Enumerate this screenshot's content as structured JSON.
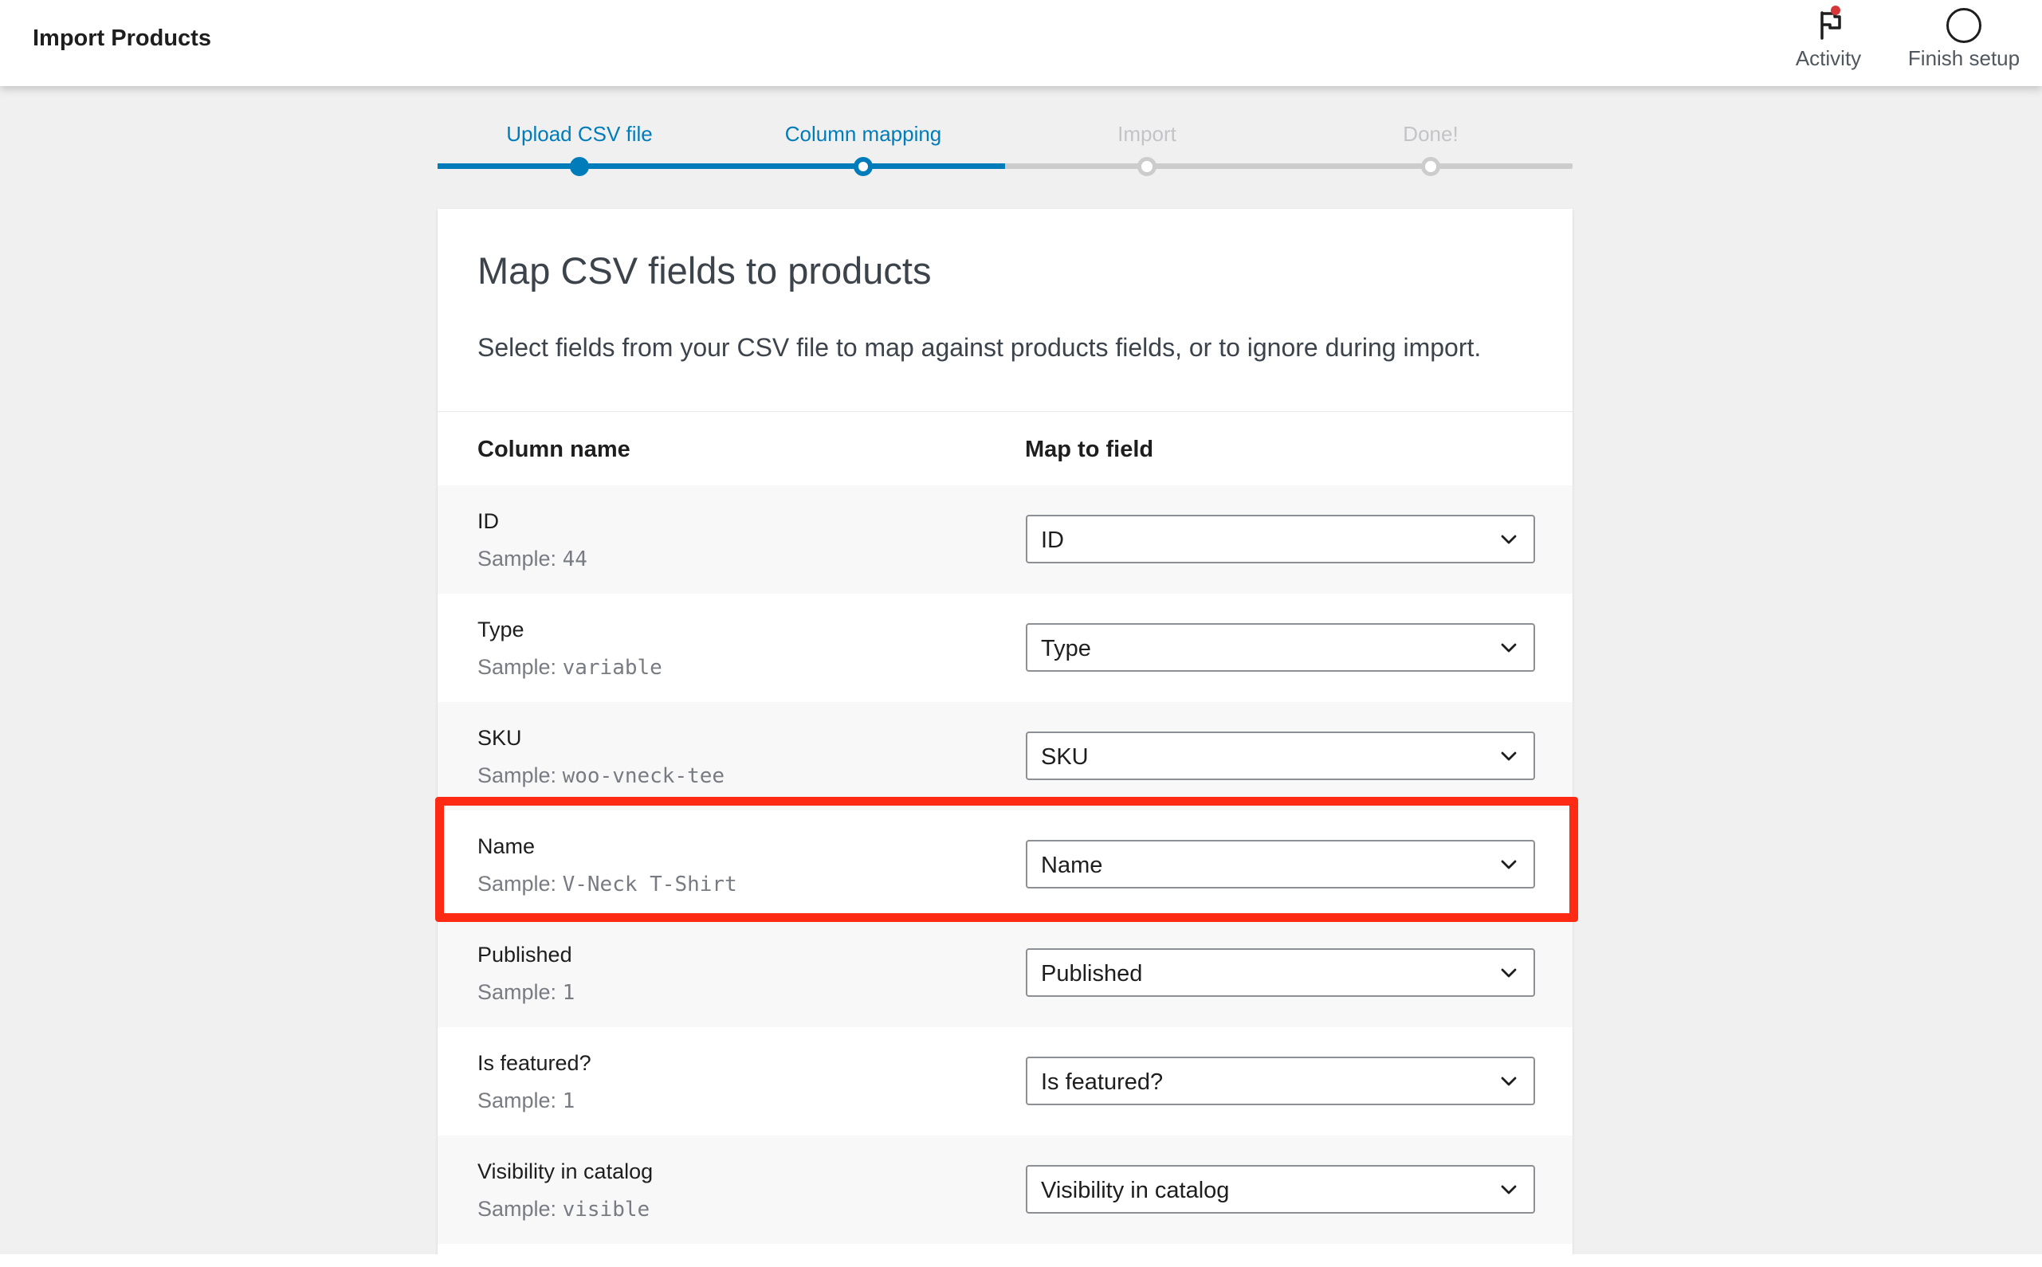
{
  "header": {
    "title": "Import Products",
    "activity_label": "Activity",
    "finish_label": "Finish setup"
  },
  "stepper": {
    "steps": [
      {
        "label": "Upload CSV file",
        "state": "done"
      },
      {
        "label": "Column mapping",
        "state": "current"
      },
      {
        "label": "Import",
        "state": "pending"
      },
      {
        "label": "Done!",
        "state": "pending"
      }
    ]
  },
  "card": {
    "title": "Map CSV fields to products",
    "description": "Select fields from your CSV file to map against products fields, or to ignore during import.",
    "col_header_name": "Column name",
    "col_header_map": "Map to field",
    "sample_prefix": "Sample:",
    "rows": [
      {
        "name": "ID",
        "sample": "44",
        "mapped": "ID"
      },
      {
        "name": "Type",
        "sample": "variable",
        "mapped": "Type"
      },
      {
        "name": "SKU",
        "sample": "woo-vneck-tee",
        "mapped": "SKU"
      },
      {
        "name": "Name",
        "sample": "V-Neck T-Shirt",
        "mapped": "Name"
      },
      {
        "name": "Published",
        "sample": "1",
        "mapped": "Published"
      },
      {
        "name": "Is featured?",
        "sample": "1",
        "mapped": "Is featured?"
      },
      {
        "name": "Visibility in catalog",
        "sample": "visible",
        "mapped": "Visibility in catalog"
      }
    ]
  },
  "colors": {
    "accent": "#007cba",
    "highlight": "#ff2a14",
    "notification": "#d63638"
  }
}
